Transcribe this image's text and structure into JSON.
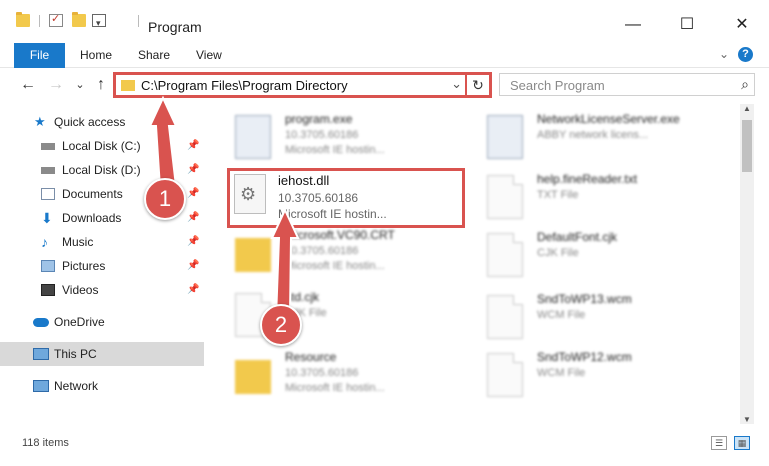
{
  "window": {
    "title": "Program",
    "minimize_glyph": "—",
    "maximize_glyph": "☐",
    "close_glyph": "✕",
    "customize_glyph": "▾"
  },
  "ribbon": {
    "file_tab": "File",
    "tabs": [
      "Home",
      "Share",
      "View"
    ],
    "expand_glyph": "⌄",
    "help_glyph": "?"
  },
  "nav": {
    "back_glyph": "←",
    "forward_glyph": "→",
    "recent_glyph": "⌄",
    "up_glyph": "↑"
  },
  "address": {
    "path": "C:\\Program Files\\Program Directory",
    "chevron_glyph": "⌄",
    "refresh_glyph": "↻"
  },
  "search": {
    "placeholder": "Search Program",
    "icon_glyph": "⌕"
  },
  "sidebar": {
    "items": [
      {
        "label": "Quick access",
        "icon": "star-icon",
        "pinned": false
      },
      {
        "label": "Local Disk (C:)",
        "icon": "drive-icon",
        "pinned": true
      },
      {
        "label": "Local Disk (D:)",
        "icon": "drive-icon",
        "pinned": true
      },
      {
        "label": "Documents",
        "icon": "documents-icon",
        "pinned": true
      },
      {
        "label": "Downloads",
        "icon": "download-icon",
        "pinned": true
      },
      {
        "label": "Music",
        "icon": "music-icon",
        "pinned": true
      },
      {
        "label": "Pictures",
        "icon": "pictures-icon",
        "pinned": true
      },
      {
        "label": "Videos",
        "icon": "videos-icon",
        "pinned": true
      },
      {
        "label": "OneDrive",
        "icon": "cloud-icon",
        "pinned": false
      },
      {
        "label": "This PC",
        "icon": "computer-icon",
        "pinned": false
      },
      {
        "label": "Network",
        "icon": "network-icon",
        "pinned": false
      }
    ],
    "pin_glyph": "📌"
  },
  "files": {
    "left": [
      {
        "name": "program.exe",
        "line2": "10.3705.60186",
        "line3": "Microsoft IE hostin..."
      },
      {
        "name": "iehost.dll",
        "line2": "10.3705.60186",
        "line3": "Microsoft IE hostin..."
      },
      {
        "name": "Microsoft.VC90.CRT",
        "line2": "10.3705.60186",
        "line3": "Microsoft IE hostin..."
      },
      {
        "name": "std.cjk",
        "line2": "CJK File",
        "line3": ""
      },
      {
        "name": "Resource",
        "line2": "10.3705.60186",
        "line3": "Microsoft IE hostin..."
      }
    ],
    "right": [
      {
        "name": "NetworkLicenseServer.exe",
        "line2": "ABBY network licens...",
        "line3": ""
      },
      {
        "name": "help.fineReader.txt",
        "line2": "TXT File",
        "line3": ""
      },
      {
        "name": "DefaultFont.cjk",
        "line2": "CJK File",
        "line3": ""
      },
      {
        "name": "SndToWP13.wcm",
        "line2": "WCM File",
        "line3": ""
      },
      {
        "name": "SndToWP12.wcm",
        "line2": "WCM File",
        "line3": ""
      }
    ]
  },
  "highlight": {
    "name": "iehost.dll",
    "version": "10.3705.60186",
    "description": "Microsoft IE hostin...",
    "gear_glyph": "⚙"
  },
  "markers": {
    "one": "1",
    "two": "2"
  },
  "status": {
    "item_count": "118 items",
    "details_glyph": "☰",
    "tiles_glyph": "▦"
  },
  "scroll": {
    "up_glyph": "▲",
    "down_glyph": "▼"
  },
  "colors": {
    "accent": "#1979ca",
    "annotation": "#d9534f",
    "folder": "#f2c94c"
  }
}
